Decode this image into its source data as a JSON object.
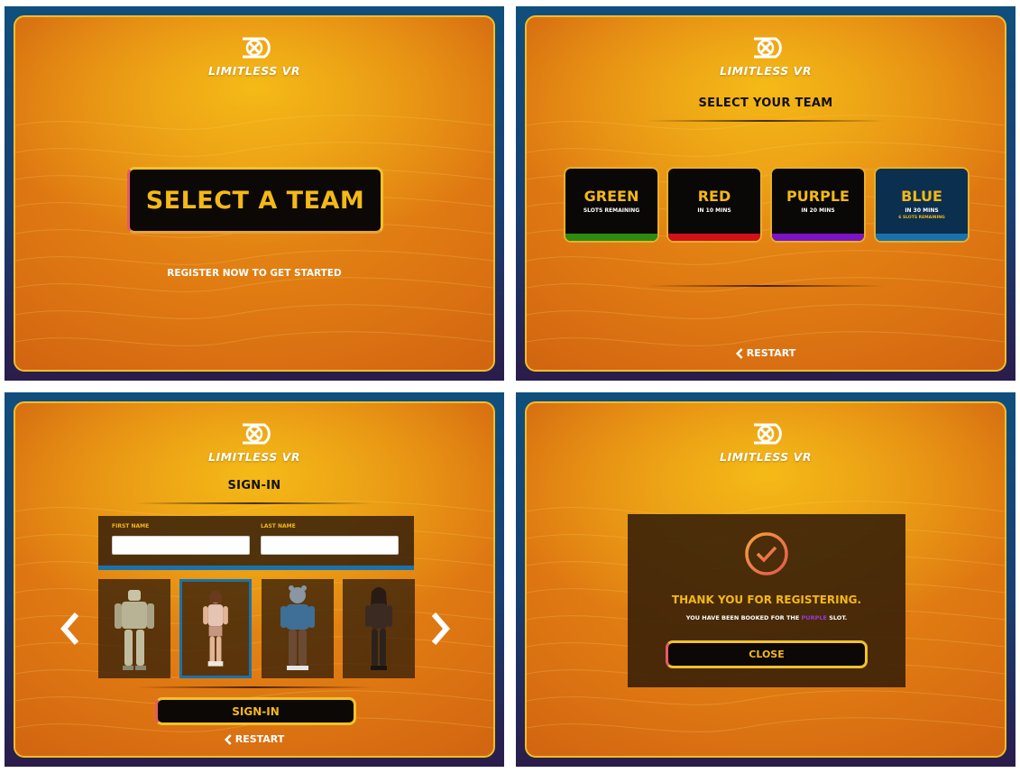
{
  "brand": {
    "logo_text": "LIMITLESS VR"
  },
  "panel_welcome": {
    "select_button": "SELECT A TEAM",
    "tagline": "REGISTER NOW TO GET STARTED"
  },
  "panel_team": {
    "title": "SELECT YOUR TEAM",
    "teams": [
      {
        "name": "GREEN",
        "status": "SLOTS REMAINING",
        "detail": "",
        "color": "#2e8b12"
      },
      {
        "name": "RED",
        "status": "IN 10 MINS",
        "detail": "",
        "color": "#d4101a"
      },
      {
        "name": "PURPLE",
        "status": "IN 20 MINS",
        "detail": "",
        "color": "#7b14c4"
      },
      {
        "name": "BLUE",
        "status": "IN 30 MINS",
        "detail": "6 SLOTS REMAINING",
        "color": "#1a72ad"
      }
    ],
    "restart_label": "RESTART"
  },
  "panel_signin": {
    "title": "SIGN-IN",
    "first_name_label": "FIRST NAME",
    "first_name_value": "",
    "last_name_label": "LAST NAME",
    "last_name_value": "",
    "characters": [
      "robot-avatar",
      "girl-avatar",
      "bear-avatar",
      "woman-avatar"
    ],
    "selected_character_index": 1,
    "signin_button": "SIGN-IN",
    "restart_label": "RESTART"
  },
  "panel_confirm": {
    "thanks": "THANK YOU FOR REGISTERING.",
    "booked_prefix": "YOU HAVE BEEN BOOKED FOR THE",
    "booked_slot": "PURPLE",
    "booked_suffix": "SLOT.",
    "close_button": "CLOSE"
  },
  "colors": {
    "accent_yellow": "#f4b817",
    "card_border": "#f2bd2a",
    "button_black": "#0b0806",
    "selection_blue": "#1a72ad"
  }
}
